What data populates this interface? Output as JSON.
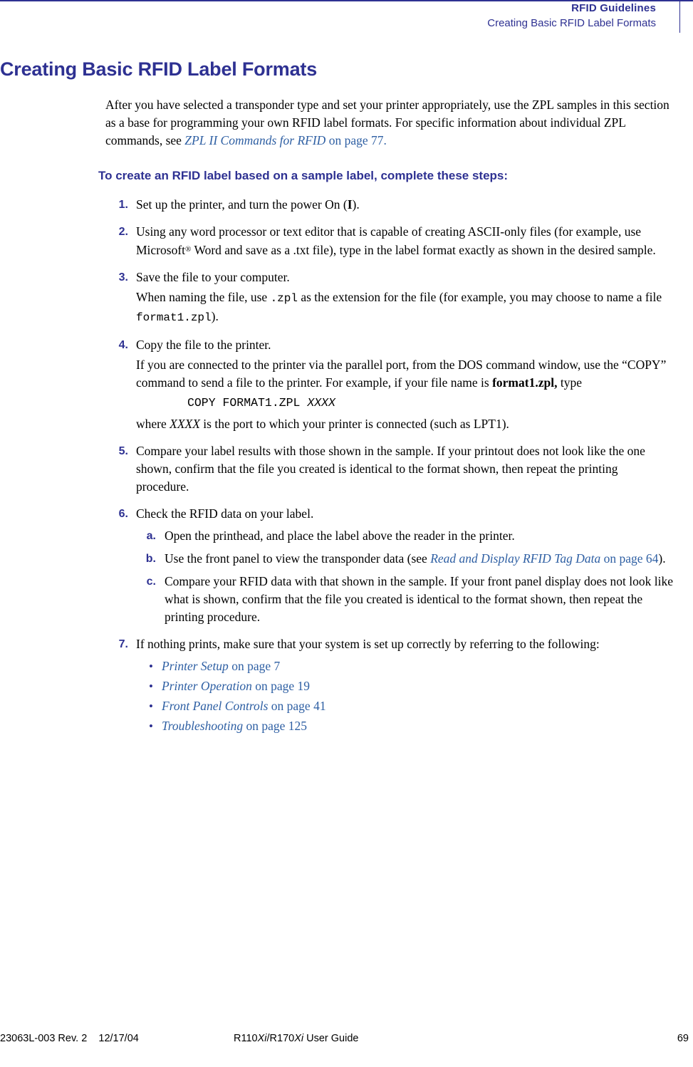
{
  "header": {
    "line1": "RFID Guidelines",
    "line2": "Creating Basic RFID Label Formats"
  },
  "title": "Creating Basic RFID Label Formats",
  "intro": {
    "part1": "After you have selected a transponder type and set your printer appropriately, use the ZPL samples in this section as a base for programming your own RFID label formats. For specific information about individual ZPL commands, see ",
    "link": "ZPL II Commands for RFID",
    "part2": " on page 77."
  },
  "section_head": "To create an RFID label based on a sample label, complete these steps:",
  "steps": [
    {
      "num": "1.",
      "text_a": "Set up the printer, and turn the power On (",
      "bold": "I",
      "text_b": ")."
    },
    {
      "num": "2.",
      "text_a": "Using any word processor or text editor that is capable of creating ASCII-only files (for example, use Microsoft",
      "reg": "®",
      "text_b": " Word and save as a .txt file), type in the label format exactly as shown in the desired sample."
    },
    {
      "num": "3.",
      "text_a": "Save the file to your computer.",
      "text_b": "When naming the file, use ",
      "code_a": ".zpl",
      "text_c": " as the extension for the file (for example, you may choose to name a file ",
      "code_b": "format1.zpl",
      "text_d": ")."
    },
    {
      "num": "4.",
      "text_a": "Copy the file to the printer.",
      "text_b": "If you are connected to the printer via the parallel port, from the DOS command window, use the “COPY” command to send a file to the printer. For example, if your file name is ",
      "bold": "format1.zpl,",
      "text_c": " type",
      "code": "COPY FORMAT1.ZPL ",
      "code_italic": "XXXX",
      "text_d": "where ",
      "italic": "XXXX",
      "text_e": " is the port to which your printer is connected (such as LPT1)."
    },
    {
      "num": "5.",
      "text_a": "Compare your label results with those shown in the sample. If your printout does not look like the one shown, confirm that the file you created is identical to the format shown, then repeat the printing procedure."
    },
    {
      "num": "6.",
      "text_a": "Check the RFID data on your label.",
      "substeps": [
        {
          "letter": "a.",
          "text": "Open the printhead, and place the label above the reader in the printer."
        },
        {
          "letter": "b.",
          "text_a": "Use the front panel to view the transponder data (see ",
          "link": "Read and Display RFID Tag Data",
          "text_b": " on page 64",
          "text_c": ")."
        },
        {
          "letter": "c.",
          "text": "Compare your RFID data with that shown in the sample. If your front panel display does not look like what is shown, confirm that the file you created is identical to the format shown, then repeat the printing procedure."
        }
      ]
    },
    {
      "num": "7.",
      "text_a": "If nothing prints, make sure that your system is set up correctly by referring to the following:",
      "bullets": [
        {
          "link": "Printer Setup",
          "suffix": " on page 7"
        },
        {
          "link": "Printer Operation",
          "suffix": " on page 19"
        },
        {
          "link": "Front Panel Controls",
          "suffix": " on page 41"
        },
        {
          "link": "Troubleshooting",
          "suffix": " on page 125"
        }
      ]
    }
  ],
  "footer": {
    "left": "23063L-003 Rev. 2    12/17/04",
    "center_a": "R110",
    "center_xi1": "Xi",
    "center_b": "/R170",
    "center_xi2": "Xi",
    "center_c": " User Guide",
    "page": "69"
  },
  "colors": {
    "heading_blue": "#2e3192",
    "link_blue": "#2e5fa3"
  }
}
